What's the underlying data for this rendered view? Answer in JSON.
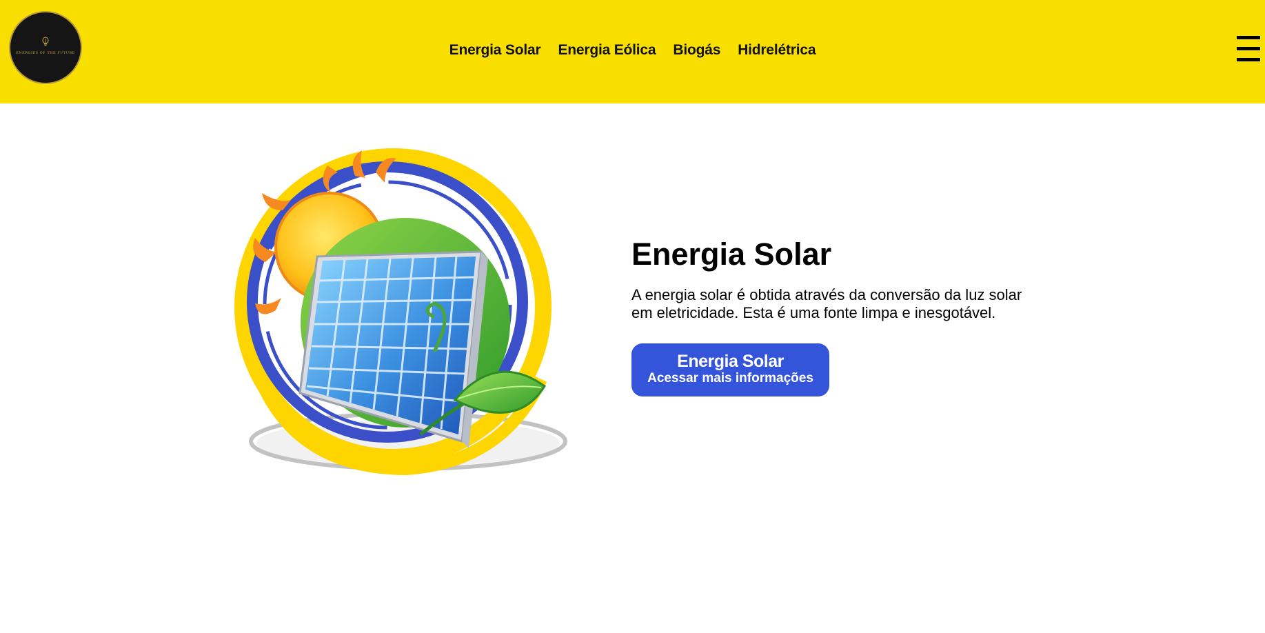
{
  "header": {
    "logo": {
      "icon": "lightbulb-emblem-icon",
      "text": "ENERGIES OF THE FUTURE"
    },
    "nav": [
      {
        "label": "Energia Solar"
      },
      {
        "label": "Energia Eólica"
      },
      {
        "label": "Biogás"
      },
      {
        "label": "Hidrelétrica"
      }
    ],
    "menu_icon": "hamburger-menu-icon"
  },
  "main": {
    "image": "solar-panel-sun-leaf-illustration",
    "title": "Energia Solar",
    "description": "A energia solar é obtida através da conversão da luz solar em eletricidade. Esta é uma fonte limpa e inesgotável.",
    "button": {
      "title": "Energia Solar",
      "subtitle": "Acessar mais informações"
    }
  },
  "colors": {
    "header_bg": "#f8df00",
    "button_bg": "#3455d9",
    "logo_bg": "#151515",
    "logo_gold": "#c9a646"
  }
}
